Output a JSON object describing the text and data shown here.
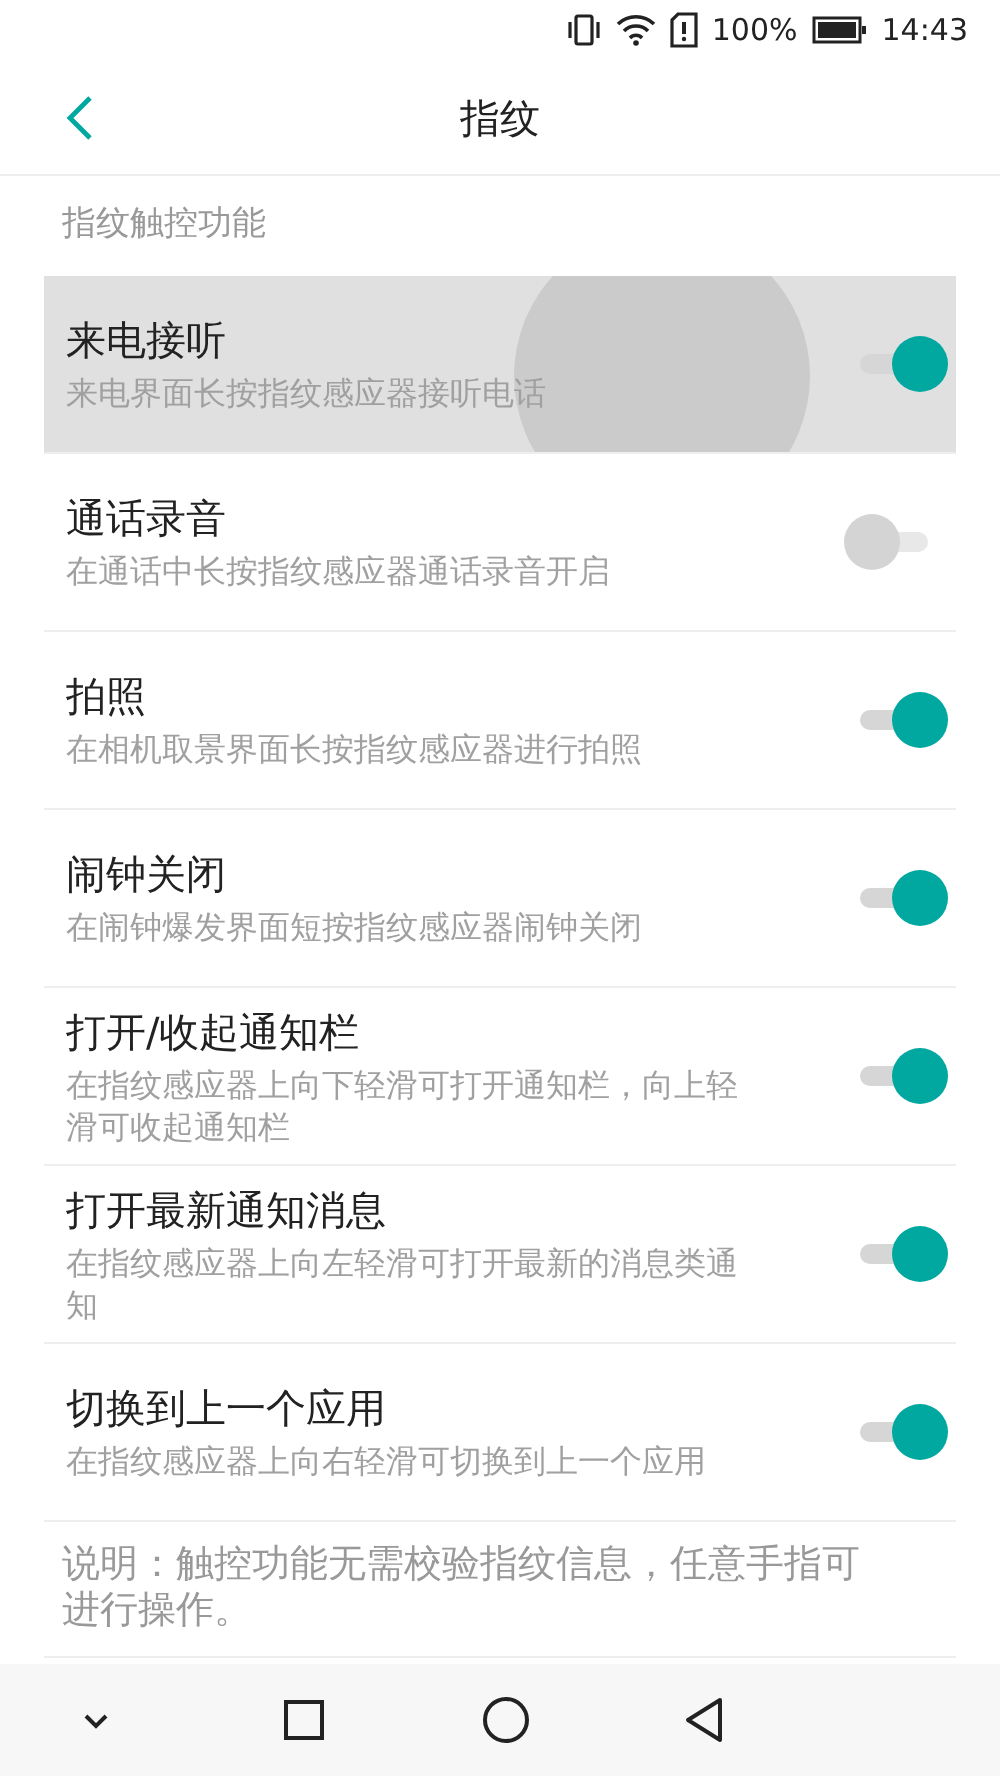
{
  "status_bar": {
    "battery": "100%",
    "time": "14:43"
  },
  "header": {
    "title": "指纹"
  },
  "section": {
    "title": "指纹触控功能"
  },
  "items": [
    {
      "title": "来电接听",
      "subtitle": "来电界面长按指纹感应器接听电话",
      "on": true,
      "pressed": true
    },
    {
      "title": "通话录音",
      "subtitle": "在通话中长按指纹感应器通话录音开启",
      "on": false,
      "pressed": false
    },
    {
      "title": "拍照",
      "subtitle": "在相机取景界面长按指纹感应器进行拍照",
      "on": true,
      "pressed": false
    },
    {
      "title": "闹钟关闭",
      "subtitle": "在闹钟爆发界面短按指纹感应器闹钟关闭",
      "on": true,
      "pressed": false
    },
    {
      "title": "打开/收起通知栏",
      "subtitle": "在指纹感应器上向下轻滑可打开通知栏，向上轻滑可收起通知栏",
      "on": true,
      "pressed": false
    },
    {
      "title": "打开最新通知消息",
      "subtitle": "在指纹感应器上向左轻滑可打开最新的消息类通知",
      "on": true,
      "pressed": false
    },
    {
      "title": "切换到上一个应用",
      "subtitle": "在指纹感应器上向右轻滑可切换到上一个应用",
      "on": true,
      "pressed": false
    }
  ],
  "note": "说明：触控功能无需校验指纹信息，任意手指可进行操作。"
}
